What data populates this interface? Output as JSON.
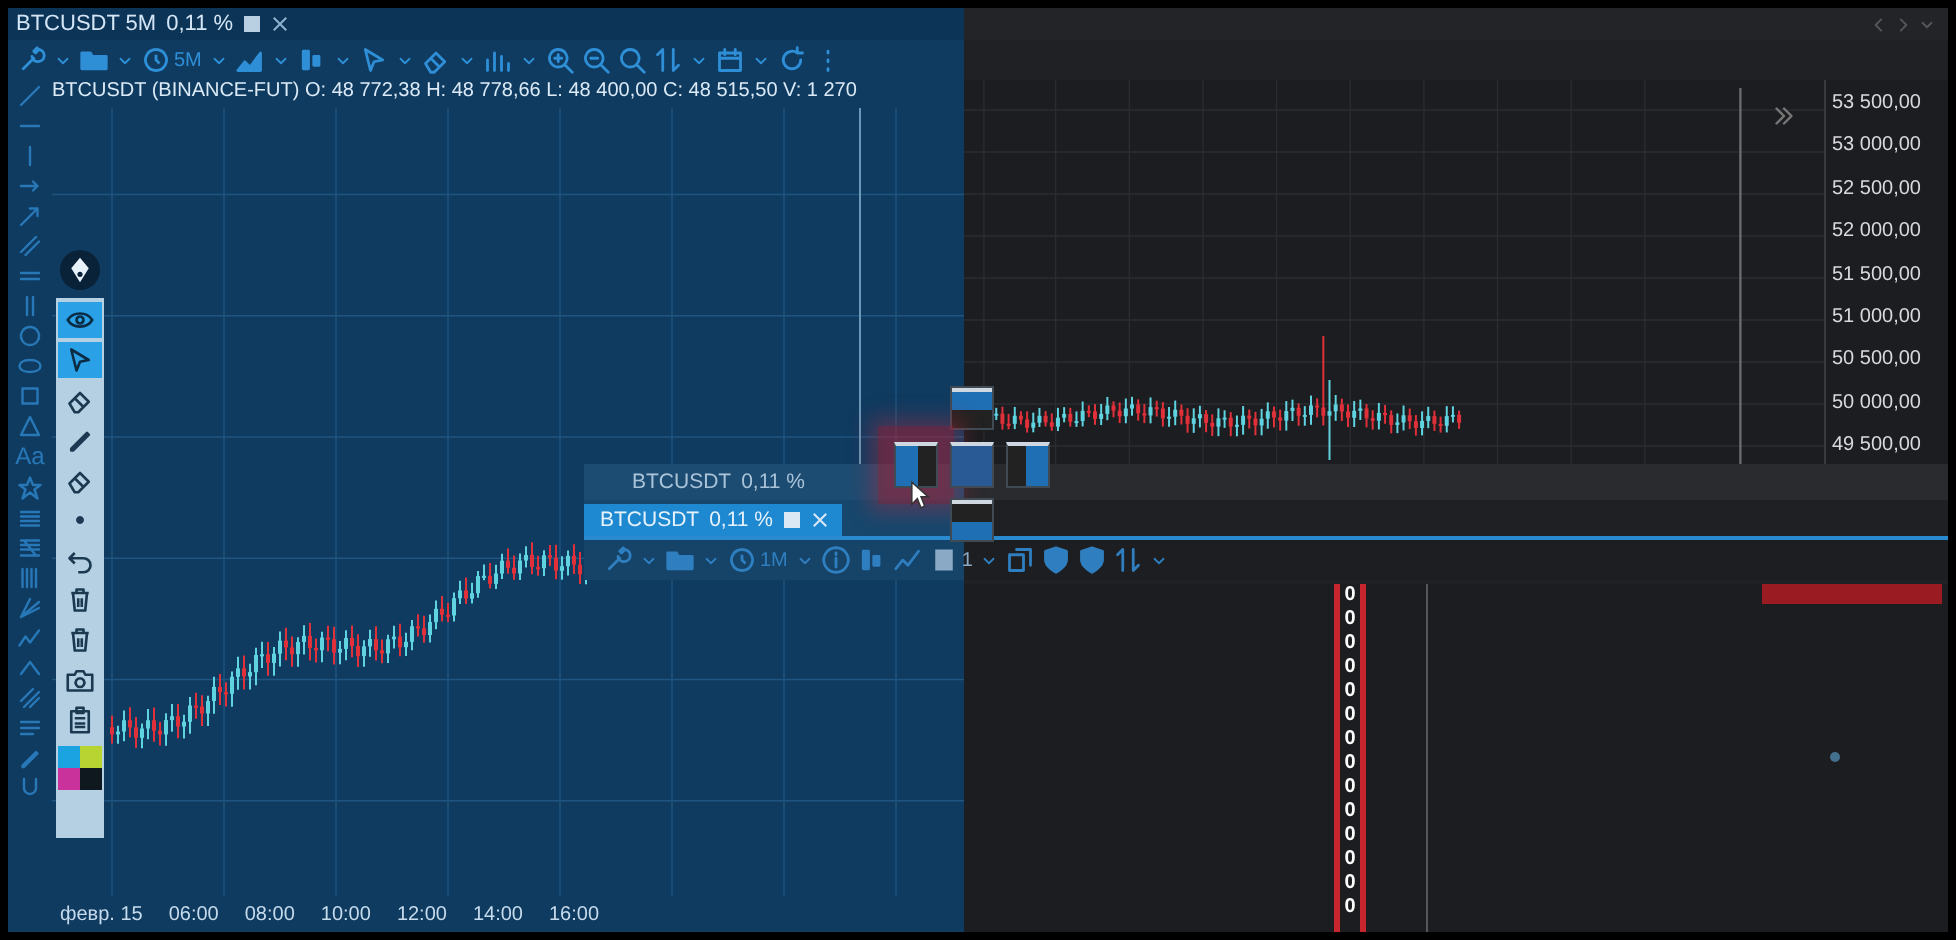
{
  "chart_window": {
    "title": "BTCUSDT 5M",
    "change": "0,11 %",
    "interval": "5M",
    "legend": "BTCUSDT (BINANCE-FUT) O: 48 772,38 H: 48 778,66 L: 48 400,00 C: 48 515,50 V: 1 270"
  },
  "drawing_tools": {
    "text_tool": "Aa"
  },
  "palette": {
    "tools": [
      {
        "kind": "eye",
        "selected": true
      },
      {
        "kind": "cursor",
        "selected": true
      },
      {
        "kind": "eraser",
        "selected": false
      },
      {
        "kind": "pencil",
        "selected": false
      },
      {
        "kind": "eraser",
        "selected": false
      },
      {
        "kind": "dot",
        "selected": false
      },
      {
        "kind": "undo",
        "selected": false
      },
      {
        "kind": "trash",
        "selected": false
      },
      {
        "kind": "trash",
        "selected": false
      },
      {
        "kind": "camera",
        "selected": false
      },
      {
        "kind": "clipboard",
        "selected": false
      }
    ],
    "swatches": [
      {
        "color": "#1aa3e0"
      },
      {
        "color": "#b8d432"
      },
      {
        "color": "#c8329a"
      },
      {
        "color": "#10181f"
      }
    ]
  },
  "price_axis": [
    "53 500,00",
    "53 000,00",
    "52 500,00",
    "52 000,00",
    "51 500,00",
    "51 000,00",
    "50 500,00",
    "50 000,00",
    "49 500,00"
  ],
  "time_axis": [
    "февр. 15",
    "06:00",
    "08:00",
    "10:00",
    "12:00",
    "14:00",
    "16:00"
  ],
  "floating_window": {
    "tabs": [
      {
        "label": "BTCUSDT",
        "change": "0,11 %",
        "selected": false
      },
      {
        "label": "BTCUSDT",
        "change": "0,11 %",
        "selected": true
      }
    ],
    "interval": "1M",
    "layout_count": "1"
  },
  "order_book": {
    "values": [
      "0",
      "0",
      "0",
      "0",
      "0",
      "0",
      "0",
      "0",
      "0",
      "0",
      "0",
      "0",
      "0",
      "0"
    ]
  }
}
